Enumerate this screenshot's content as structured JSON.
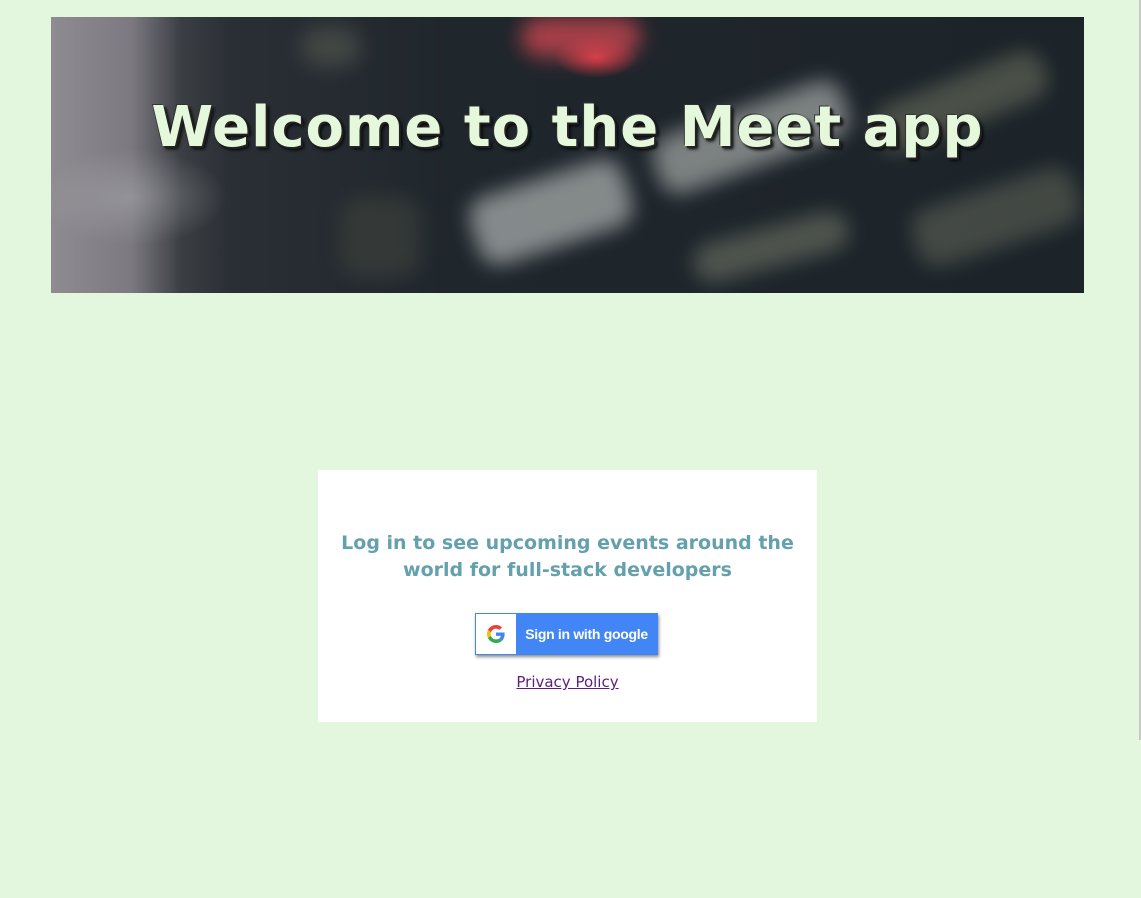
{
  "header": {
    "title": "Welcome to the Meet app"
  },
  "login": {
    "message": "Log in to see upcoming events around the world for full-stack developers",
    "google_button_label": "Sign in with google",
    "google_icon": "google-g-logo",
    "privacy_link_label": "Privacy Policy"
  },
  "colors": {
    "background": "#e3f7df",
    "card": "#ffffff",
    "message_text": "#64a0ad",
    "google_blue": "#4285f4",
    "link_visited": "#5a1f7a",
    "hero_title": "#e6f8dc"
  }
}
